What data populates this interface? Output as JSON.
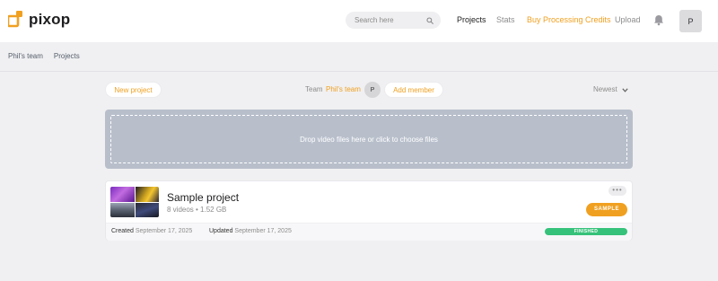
{
  "app": {
    "name": "pixop",
    "brand_color": "#f0a020"
  },
  "header": {
    "search": {
      "placeholder": "Search here",
      "value": ""
    },
    "nav": {
      "projects": "Projects",
      "stats": "Stats",
      "buy_credits": "Buy Processing Credits",
      "upload": "Upload"
    },
    "icons": {
      "search": "search-icon",
      "notifications": "bell-icon"
    },
    "avatar_initial": "P"
  },
  "breadcrumb": [
    "Phil's team",
    "Projects"
  ],
  "toolbar": {
    "new_project": "New project",
    "team_label": "Team",
    "team_name": "Phil's team",
    "member_initial": "P",
    "add_member": "Add member",
    "sort": "Newest"
  },
  "dropzone": {
    "text": "Drop video files here or click to choose files"
  },
  "project": {
    "name": "Sample project",
    "meta": "8 videos • 1.52 GB",
    "badge": "SAMPLE",
    "more": "•••",
    "created_label": "Created",
    "created_date": "September 17, 2025",
    "updated_label": "Updated",
    "updated_date": "September 17, 2025",
    "status": "FINISHED",
    "status_color": "#36c27a"
  }
}
